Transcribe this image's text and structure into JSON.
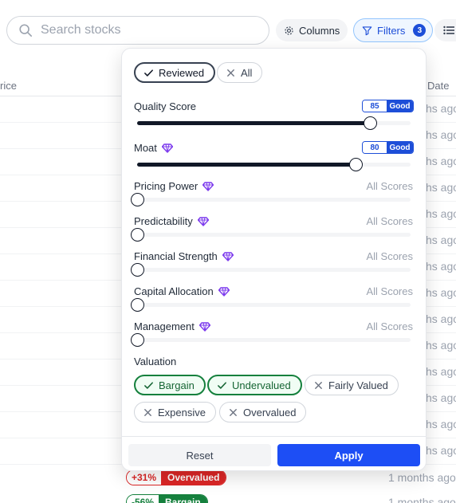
{
  "toolbar": {
    "search_placeholder": "Search stocks",
    "columns_label": "Columns",
    "filters_label": "Filters",
    "filters_count": "3"
  },
  "table": {
    "header_price": "rice",
    "header_date": "Date",
    "date_cells": [
      "hs ago",
      "hs ago",
      "hs ago",
      "hs ago",
      "hs ago",
      "hs ago",
      "hs ago",
      "hs ago",
      "hs ago",
      "hs ago",
      "hs ago",
      "hs ago",
      "hs ago",
      "hs ago"
    ],
    "visible_rows": [
      {
        "pct": "+31%",
        "valuation": "Overvalued",
        "date": "1 months ago",
        "color": "#dc2626"
      },
      {
        "pct": "-56%",
        "valuation": "Bargain",
        "date": "1 months ago",
        "color": "#15803d"
      }
    ]
  },
  "filters": {
    "scope_chips": [
      {
        "label": "Reviewed",
        "state": "selected"
      },
      {
        "label": "All",
        "state": "unselected"
      }
    ],
    "sliders": [
      {
        "label": "Quality Score",
        "value": 85,
        "rating": "Good",
        "premium": false
      },
      {
        "label": "Moat",
        "value": 80,
        "rating": "Good",
        "premium": true
      },
      {
        "label": "Pricing Power",
        "value_text": "All Scores",
        "premium": true,
        "value": 0
      },
      {
        "label": "Predictability",
        "value_text": "All Scores",
        "premium": true,
        "value": 0
      },
      {
        "label": "Financial Strength",
        "value_text": "All Scores",
        "premium": true,
        "value": 0
      },
      {
        "label": "Capital Allocation",
        "value_text": "All Scores",
        "premium": true,
        "value": 0
      },
      {
        "label": "Management",
        "value_text": "All Scores",
        "premium": true,
        "value": 0
      }
    ],
    "valuation": {
      "label": "Valuation",
      "chips": [
        {
          "label": "Bargain",
          "state": "selected"
        },
        {
          "label": "Undervalued",
          "state": "selected"
        },
        {
          "label": "Fairly Valued",
          "state": "unselected"
        },
        {
          "label": "Expensive",
          "state": "unselected"
        },
        {
          "label": "Overvalued",
          "state": "unselected"
        }
      ]
    },
    "reset_label": "Reset",
    "apply_label": "Apply"
  },
  "colors": {
    "accent": "#1d4ed8",
    "apply": "#1d4ef5",
    "selected_green": "#15803d",
    "premium_gem": "#7c3aed"
  }
}
